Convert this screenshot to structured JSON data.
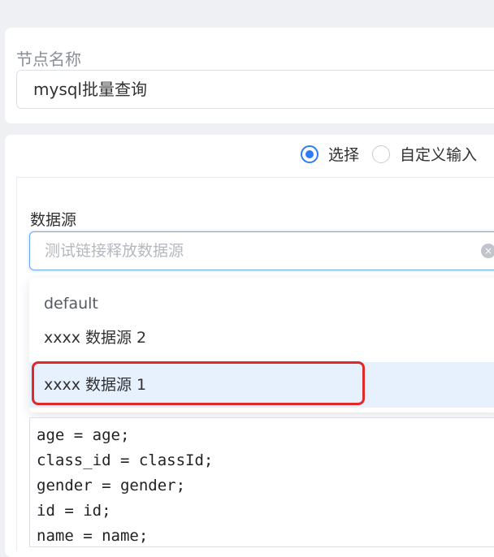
{
  "node": {
    "label": "节点名称",
    "name_value": "mysql批量查询"
  },
  "mode": {
    "options": [
      {
        "label": "选择",
        "checked": true
      },
      {
        "label": "自定义输入",
        "checked": false
      }
    ]
  },
  "datasource": {
    "label": "数据源",
    "placeholder": "测试链接释放数据源",
    "clear_icon": "×",
    "options": [
      "default",
      "xxxx 数据源 2",
      "xxxx 数据源 1"
    ],
    "hovered_index": 2
  },
  "code": {
    "lines": [
      "age = age;",
      "class_id = classId;",
      "gender = gender;",
      "id = id;",
      "name = name;"
    ]
  },
  "colors": {
    "accent": "#2d7cf6",
    "highlight_border": "#e02a2a",
    "hover_bg": "#e6f1fd"
  }
}
